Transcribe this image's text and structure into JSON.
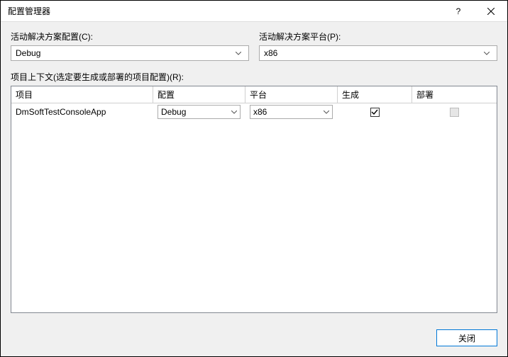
{
  "title": "配置管理器",
  "labels": {
    "activeConfig": "活动解决方案配置(C):",
    "activePlatform": "活动解决方案平台(P):",
    "context": "项目上下文(选定要生成或部署的项目配置)(R):"
  },
  "activeConfigValue": "Debug",
  "activePlatformValue": "x86",
  "grid": {
    "headers": {
      "project": "项目",
      "config": "配置",
      "platform": "平台",
      "build": "生成",
      "deploy": "部署"
    },
    "rows": [
      {
        "project": "DmSoftTestConsoleApp",
        "config": "Debug",
        "platform": "x86",
        "build": true,
        "deploy": false,
        "deployEnabled": false
      }
    ]
  },
  "closeButton": "关闭"
}
